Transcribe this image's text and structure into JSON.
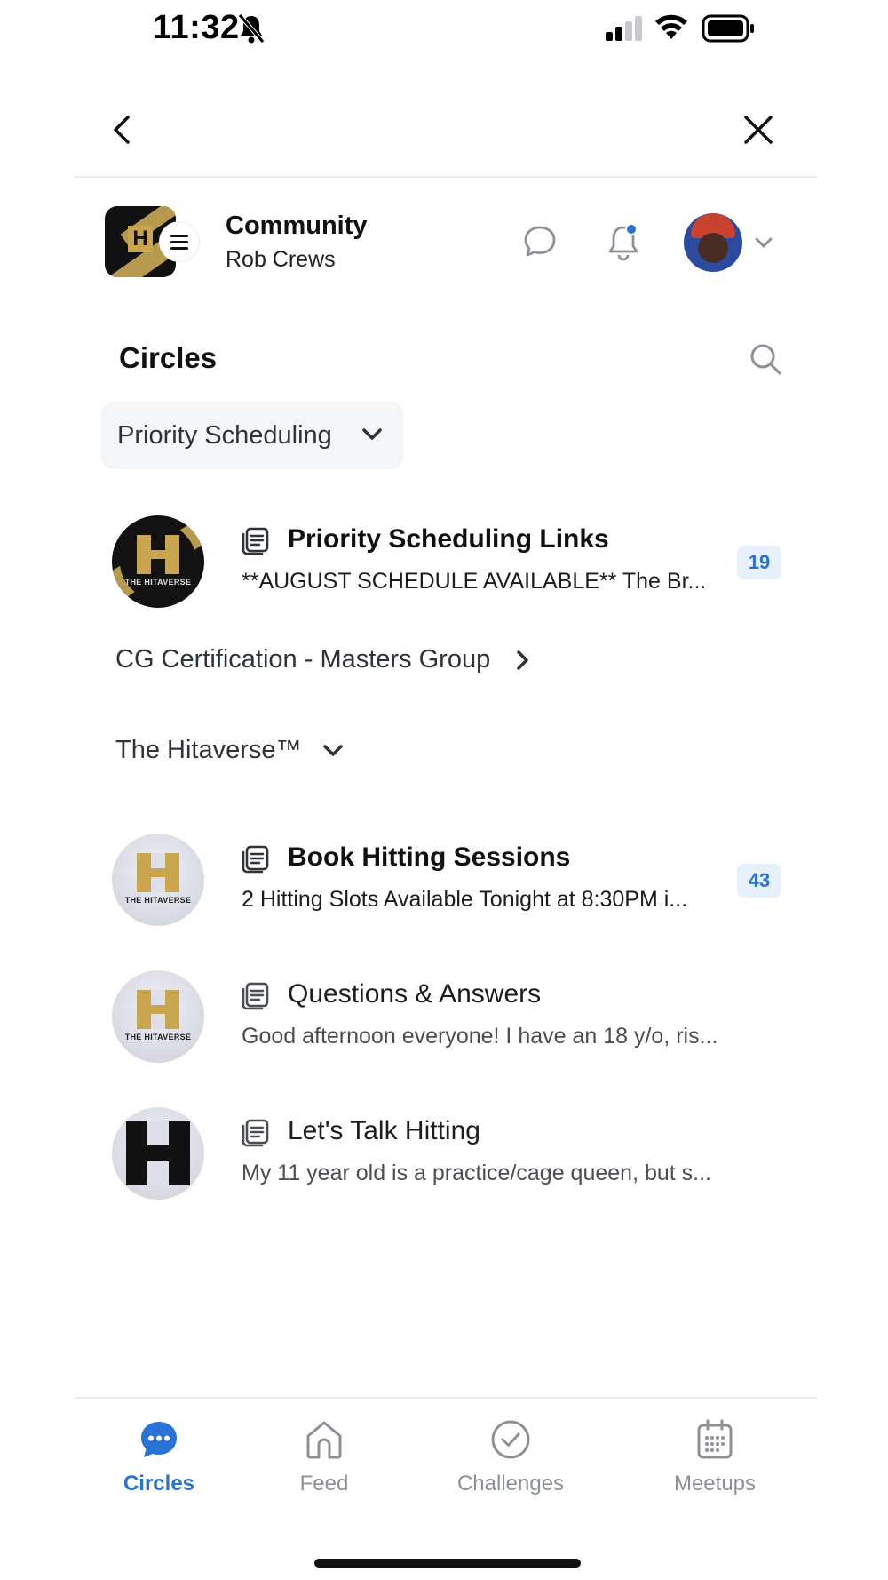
{
  "status_bar": {
    "time": "11:32",
    "icons": [
      "bell-off-icon",
      "signal-icon",
      "wifi-icon",
      "battery-icon"
    ]
  },
  "nav": {
    "back_icon": "chevron-left-icon",
    "close_icon": "close-icon"
  },
  "community": {
    "title": "Community",
    "user_name": "Rob Crews",
    "icons": [
      "hamburger-menu-icon",
      "chat-bubble-icon",
      "bell-icon",
      "chevron-down-icon"
    ],
    "notification_dot_color": "#2a73d6"
  },
  "circles": {
    "title": "Circles",
    "search_icon": "search-icon",
    "groups": [
      {
        "label": "Priority Scheduling",
        "expanded": true,
        "spaces": [
          {
            "name": "Priority Scheduling Links",
            "preview": "**AUGUST SCHEDULE AVAILABLE** The Br...",
            "unread": "19",
            "bold": true
          }
        ]
      },
      {
        "label": "CG Certification - Masters Group",
        "expanded": false,
        "spaces": []
      },
      {
        "label": "The Hitaverse™",
        "expanded": true,
        "spaces": [
          {
            "name": "Book Hitting Sessions",
            "preview": "2 Hitting Slots Available Tonight at 8:30PM i...",
            "unread": "43",
            "bold": true
          },
          {
            "name": "Questions & Answers",
            "preview": "Good afternoon everyone! I have an 18 y/o, ris...",
            "unread": "",
            "bold": false
          },
          {
            "name": "Let's Talk Hitting",
            "preview": "My 11 year old is a practice/cage queen, but s...",
            "unread": "",
            "bold": false
          }
        ]
      }
    ]
  },
  "tabs": [
    {
      "label": "Circles",
      "icon": "chat-bubble-filled-icon",
      "active": true
    },
    {
      "label": "Feed",
      "icon": "home-icon",
      "active": false
    },
    {
      "label": "Challenges",
      "icon": "check-circle-icon",
      "active": false
    },
    {
      "label": "Meetups",
      "icon": "calendar-icon",
      "active": false
    }
  ],
  "colors": {
    "accent": "#2a73d6",
    "badge_bg": "#e6f1fc",
    "brand_gold": "#c9a54e",
    "pill_bg": "#f4f6f8"
  }
}
